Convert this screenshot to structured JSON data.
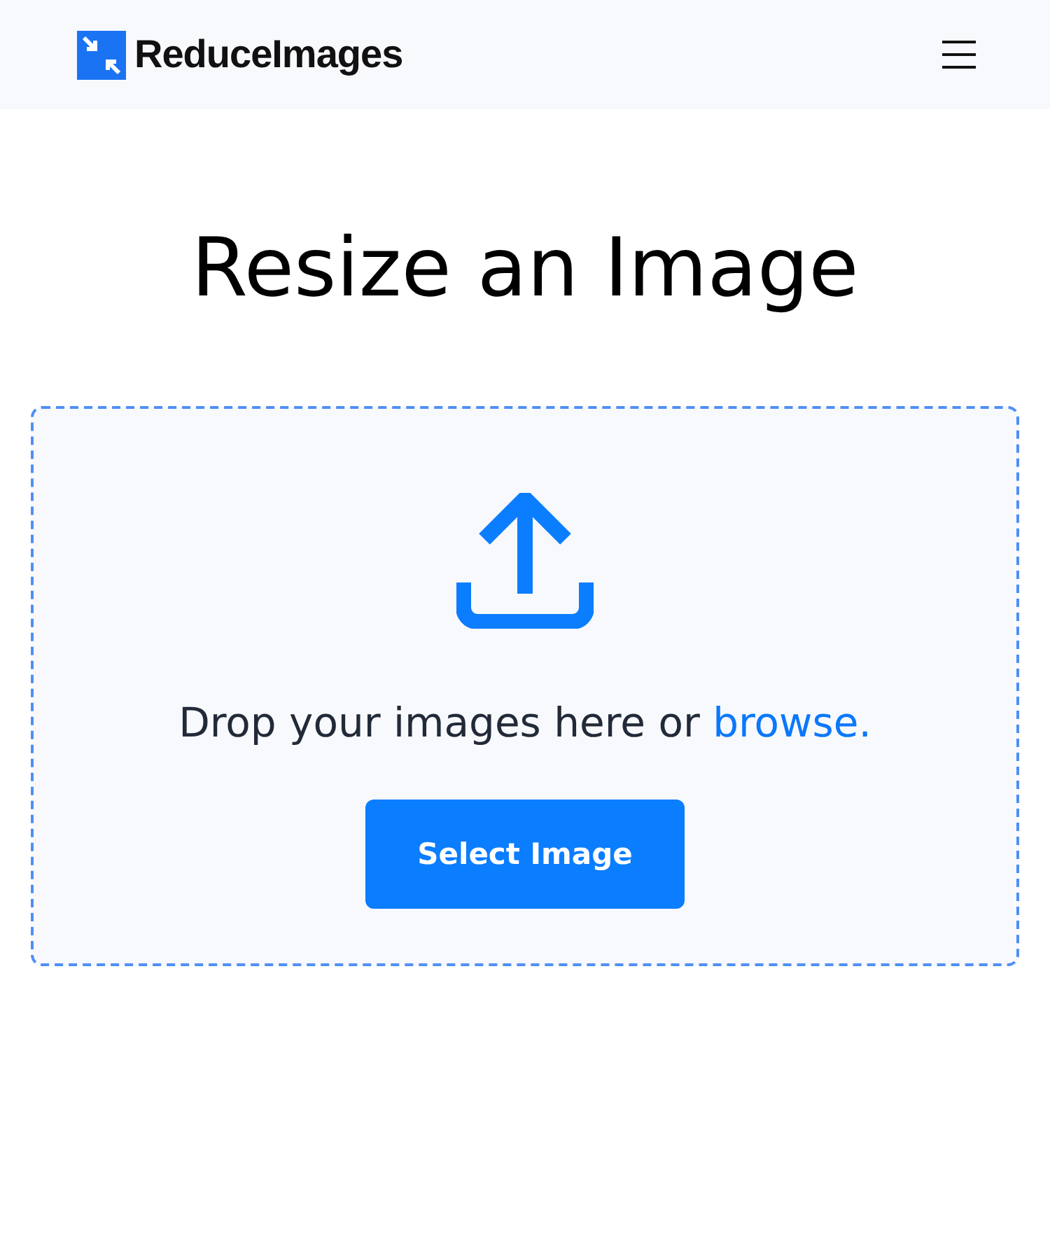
{
  "header": {
    "logo_text": "ReduceImages"
  },
  "title": "Resize an Image",
  "dropzone": {
    "prompt": "Drop your images here or ",
    "link": "browse.",
    "button": "Select Image"
  }
}
